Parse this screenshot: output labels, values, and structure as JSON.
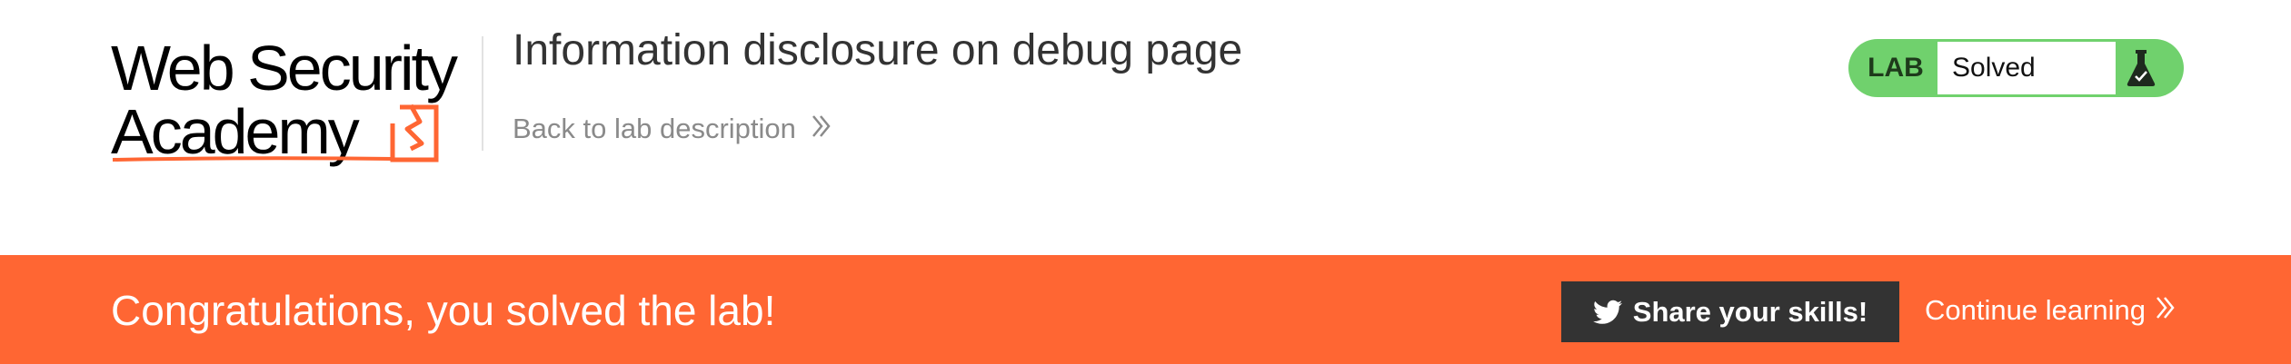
{
  "logo": {
    "line1": "Web Security",
    "line2": "Academy",
    "icon": "academy-lightning-icon",
    "accent_color": "#ff6633"
  },
  "header": {
    "title": "Information disclosure on debug page",
    "back_link": "Back to lab description",
    "back_icon": "double-chevron-right-icon"
  },
  "lab_status": {
    "label": "LAB",
    "value": "Solved",
    "icon": "flask-check-icon",
    "color": "#70d16d"
  },
  "banner": {
    "message": "Congratulations, you solved the lab!",
    "share_label": "Share your skills!",
    "share_icon": "twitter-icon",
    "continue_label": "Continue learning",
    "continue_icon": "double-chevron-right-icon",
    "background": "#ff6633"
  }
}
